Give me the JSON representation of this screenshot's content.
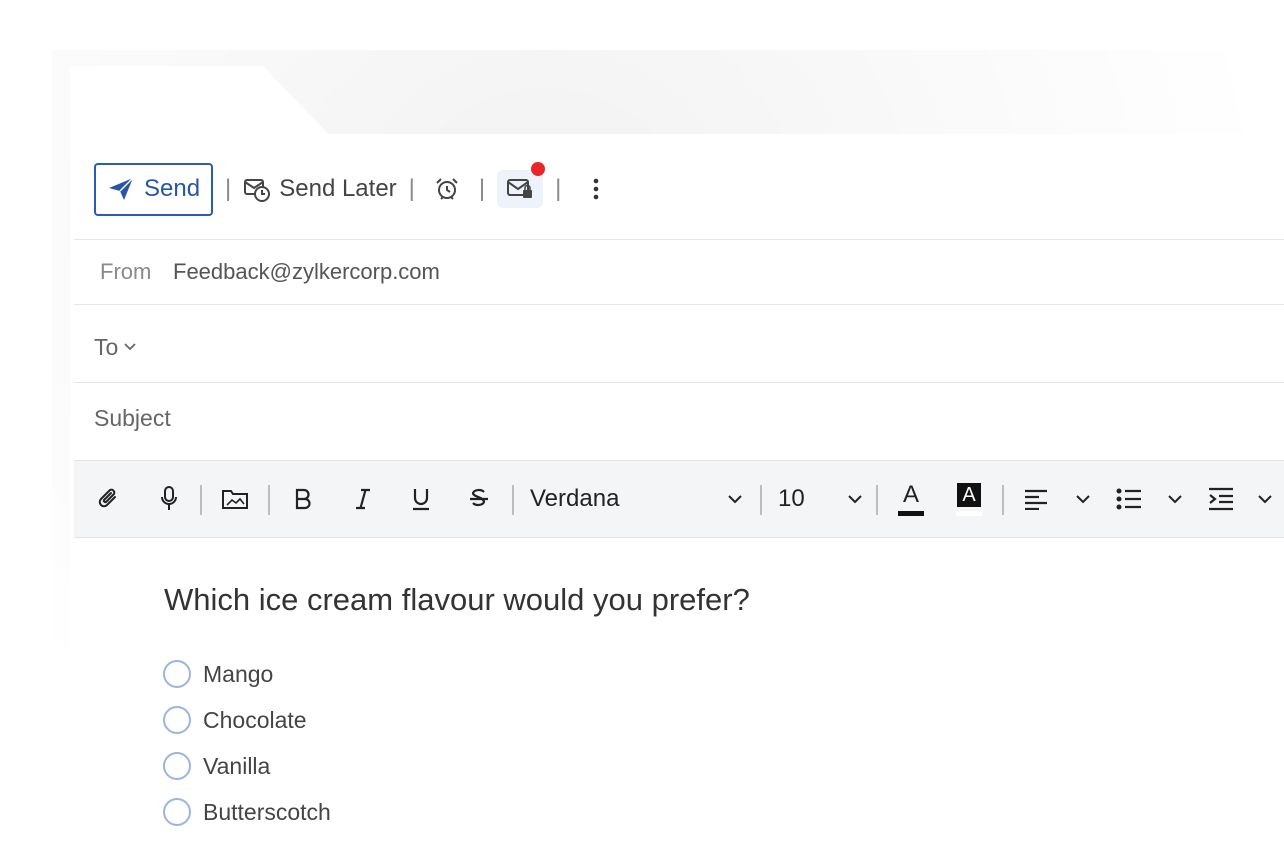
{
  "toolbar": {
    "send_label": "Send",
    "send_later_label": "Send Later",
    "separator": "|"
  },
  "from": {
    "label": "From",
    "value": "Feedback@zylkercorp.com"
  },
  "to": {
    "label": "To"
  },
  "subject": {
    "label": "Subject"
  },
  "format": {
    "font": "Verdana",
    "size": "10",
    "text_color_glyph": "A",
    "bg_color_glyph": "A"
  },
  "body": {
    "question": "Which ice cream flavour would you prefer?",
    "options": [
      "Mango",
      "Chocolate",
      "Vanilla",
      "Butterscotch"
    ]
  },
  "colors": {
    "accent": "#2756a8",
    "notification": "#e8262a"
  }
}
